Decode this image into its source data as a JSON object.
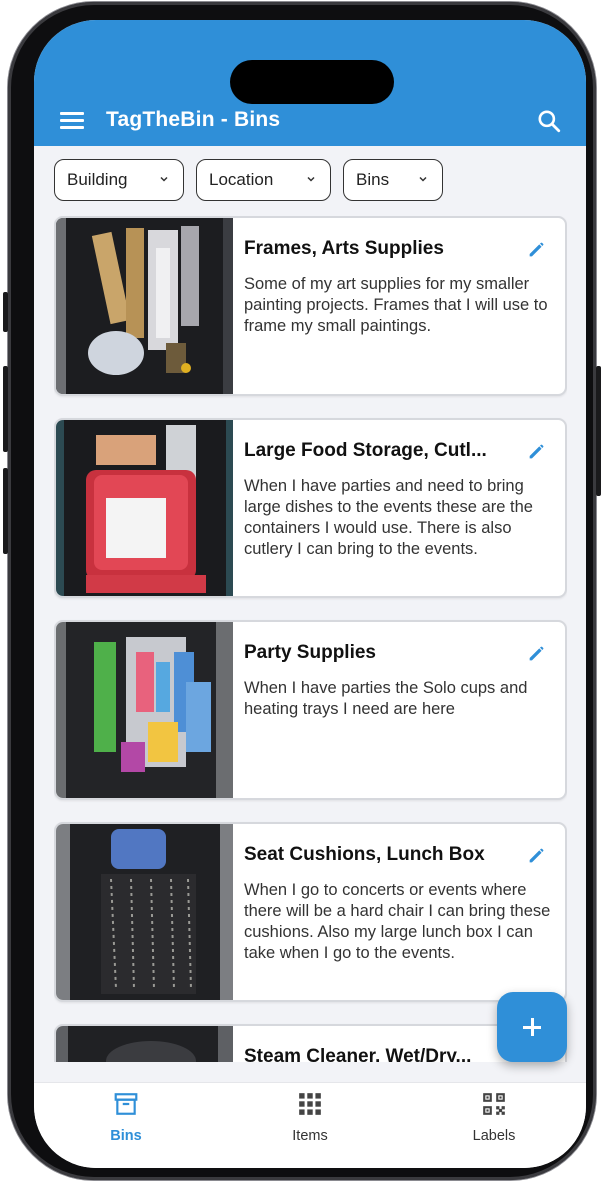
{
  "app": {
    "title": "TagTheBin - Bins"
  },
  "filters": [
    {
      "label": "Building"
    },
    {
      "label": "Location"
    },
    {
      "label": "Bins"
    }
  ],
  "bins": [
    {
      "title": "Frames, Arts Supplies",
      "description": "Some of my art supplies for my smaller painting projects. Frames that I will use to frame my small paintings."
    },
    {
      "title": "Large Food Storage, Cutl...",
      "description": "When I have parties and need to bring large dishes to the events these are the containers I would use. There is also cutlery I can bring to the events."
    },
    {
      "title": "Party Supplies",
      "description": "When I have parties the Solo cups and heating trays I need are here"
    },
    {
      "title": "Seat Cushions, Lunch Box",
      "description": "When I go to concerts or events where there will be a hard chair I can bring these cushions. Also my large lunch box I can take when I go to the events."
    },
    {
      "title": "Steam Cleaner, Wet/Dry...",
      "description": ""
    }
  ],
  "nav": [
    {
      "label": "Bins",
      "icon": "archive-box-icon",
      "active": true
    },
    {
      "label": "Items",
      "icon": "grid-icon",
      "active": false
    },
    {
      "label": "Labels",
      "icon": "qr-code-icon",
      "active": false
    }
  ],
  "colors": {
    "primary": "#2f8fd8",
    "background": "#f2f3f7"
  }
}
